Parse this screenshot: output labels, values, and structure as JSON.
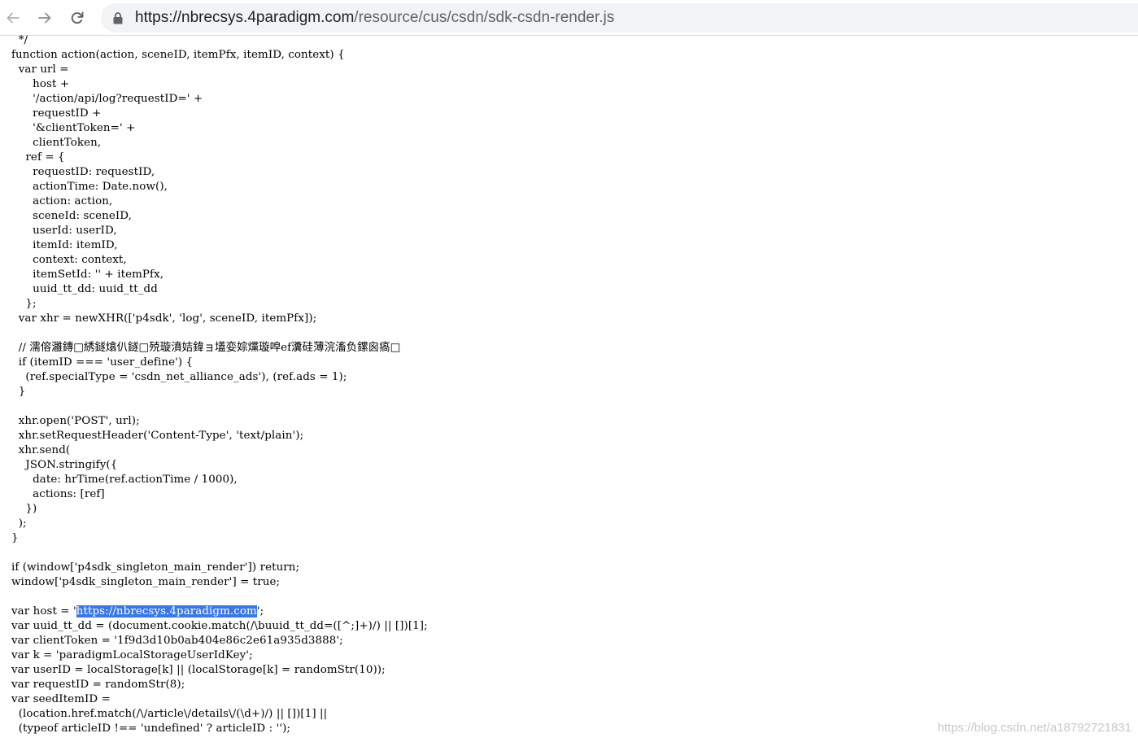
{
  "browser": {
    "url_host": "https://nbrecsys.4paradigm.com",
    "url_path": "/resource/cus/csdn/sdk-csdn-render.js",
    "icons": {
      "back": "back-arrow-icon",
      "forward": "forward-arrow-icon",
      "reload": "reload-icon",
      "lock": "lock-icon"
    }
  },
  "code": {
    "lines": [
      "  */",
      "function action(action, sceneID, itemPfx, itemID, context) {",
      "  var url =",
      "      host +",
      "      '/action/api/log?requestID=' +",
      "      requestID +",
      "      '&clientToken=' +",
      "      clientToken,",
      "    ref = {",
      "      requestID: requestID,",
      "      actionTime: Date.now(),",
      "      action: action,",
      "      sceneId: sceneID,",
      "      userId: userID,",
      "      itemId: itemID,",
      "      context: context,",
      "      itemSetId: '' + itemPfx,",
      "      uuid_tt_dd: uuid_tt_dd",
      "    };",
      "  var xhr = newXHR(['p4sdk', 'log', sceneID, itemPfx]);",
      "",
      "  // 濡傛灉鏄□綉鐩熻仈鐩□殑璇濆姞鍏ョ壒娈婃爣璇唕ef瀵硅薄浣滀负鏍囪瘑□",
      "  if (itemID === 'user_define') {",
      "    (ref.specialType = 'csdn_net_alliance_ads'), (ref.ads = 1);",
      "  }",
      "",
      "  xhr.open('POST', url);",
      "  xhr.setRequestHeader('Content-Type', 'text/plain');",
      "  xhr.send(",
      "    JSON.stringify({",
      "      date: hrTime(ref.actionTime / 1000),",
      "      actions: [ref]",
      "    })",
      "  );",
      "}",
      "",
      "if (window['p4sdk_singleton_main_render']) return;",
      "window['p4sdk_singleton_main_render'] = true;",
      "",
      "var host = 'https://nbrecsys.4paradigm.com';",
      "var uuid_tt_dd = (document.cookie.match(/\\buuid_tt_dd=([^;]+)/) || [])[1];",
      "var clientToken = '1f9d3d10b0ab404e86c2e61a935d3888';",
      "var k = 'paradigmLocalStorageUserIdKey';",
      "var userID = localStorage[k] || (localStorage[k] = randomStr(10));",
      "var requestID = randomStr(8);",
      "var seedItemID =",
      "  (location.href.match(/\\/article\\/details\\/(\\d+)/) || [])[1] ||",
      "  (typeof articleID !== 'undefined' ? articleID : '');"
    ],
    "selected_line_index": 39,
    "selected_prefix": "var host = '",
    "selected_text": "https://nbrecsys.4paradigm.com",
    "selected_suffix": "';"
  },
  "watermark": "https://blog.csdn.net/a18792721831",
  "colors": {
    "selection": "#3b78e7",
    "omnibox_bg": "#f1f3f4",
    "icon": "#5f6368"
  }
}
